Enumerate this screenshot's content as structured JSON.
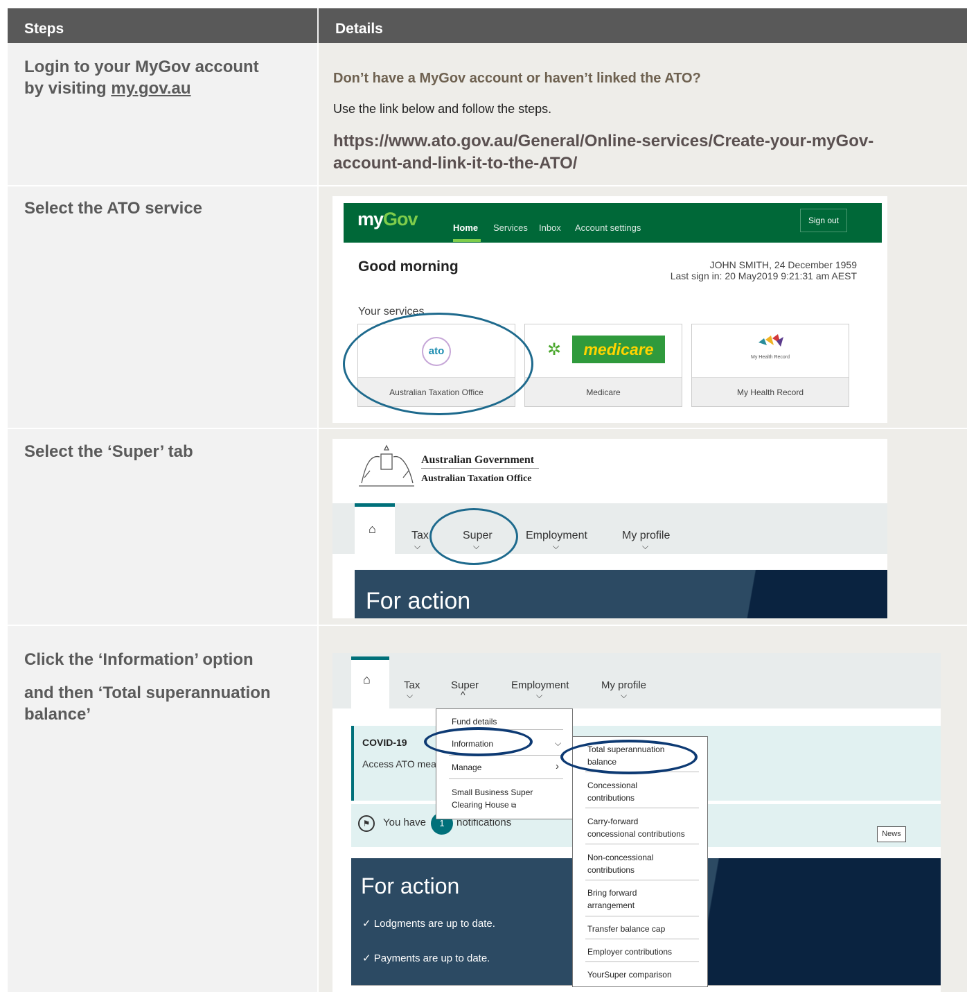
{
  "table": {
    "header_steps": "Steps",
    "header_details": "Details"
  },
  "row1": {
    "step_line1": "Login to your MyGov account",
    "step_line2_prefix": "by visiting ",
    "step_link": "my.gov.au",
    "detail_heading": "Don’t have a MyGov account or haven’t linked the ATO?",
    "detail_text": "Use the link below and follow the steps.",
    "detail_url_line1": "https://www.ato.gov.au/General/Online-services/Create-your-myGov-",
    "detail_url_line2": "account-and-link-it-to-the-ATO/"
  },
  "row2": {
    "step": "Select the ATO service",
    "mygov": {
      "logo_my": "my",
      "logo_gov": "Gov",
      "nav": [
        "Home",
        "Services",
        "Inbox",
        "Account settings"
      ],
      "sign_out": "Sign out",
      "greeting": "Good morning",
      "user_line": "JOHN SMITH, 24 December 1959",
      "last_sign_in": "Last sign in: 20 May2019   9:21:31 am AEST",
      "services_heading": "Your services",
      "services": [
        {
          "logo": "ato",
          "label": "Australian Taxation Office"
        },
        {
          "logo": "medicare",
          "label": "Medicare"
        },
        {
          "logo": "My Health Record",
          "label": "My Health Record"
        }
      ]
    }
  },
  "row3": {
    "step": "Select the ‘Super’ tab",
    "gov_line1": "Australian Government",
    "gov_line2": "Australian Taxation Office",
    "nav": [
      "Tax",
      "Super",
      "Employment",
      "My profile"
    ],
    "banner": "For action"
  },
  "row4": {
    "step_line1": "Click the ‘Information’ option",
    "step_line2": "and then ‘Total superannuation",
    "step_line3": "balance’",
    "nav": [
      "Tax",
      "Super",
      "Employment",
      "My profile"
    ],
    "covid_title": "COVID-19",
    "covid_text": "Access ATO mea",
    "menu1": [
      "Fund details",
      "Information",
      "Manage",
      "Small Business Super",
      "Clearing House"
    ],
    "menu2": [
      [
        "Total superannuation",
        "balance"
      ],
      [
        "Concessional",
        "contributions"
      ],
      [
        "Carry-forward",
        "concessional contributions"
      ],
      [
        "Non-concessional",
        "contributions"
      ],
      [
        "Bring forward",
        "arrangement"
      ],
      [
        "Transfer balance cap"
      ],
      [
        "Employer contributions"
      ],
      [
        "YourSuper comparison"
      ]
    ],
    "notif_prefix": "You have",
    "notif_count": "1",
    "notif_suffix": "notifications",
    "news": "News",
    "banner": "For action",
    "status1": "Lodgments are up to date.",
    "status2": "Payments are up to date."
  },
  "colors": {
    "header_bg": "#595959",
    "mygov_green": "#006838",
    "ato_teal": "#00707a",
    "banner_dark": "#1f3f57"
  }
}
